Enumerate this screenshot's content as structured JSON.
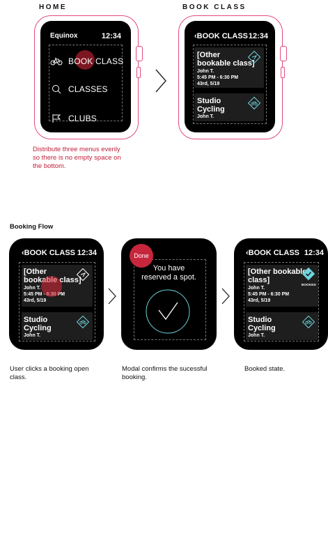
{
  "sections": {
    "home_label": "HOME",
    "book_class_label": "BOOK CLASS",
    "flow_label": "Booking Flow"
  },
  "home_screen": {
    "brand": "Equinox",
    "time": "12:34",
    "menu": [
      {
        "label": "BOOK CLASS",
        "icon": "bicycle-icon"
      },
      {
        "label": "CLASSES",
        "icon": "search-icon"
      },
      {
        "label": "CLUBS",
        "icon": "flag-icon"
      }
    ]
  },
  "book_class_screen": {
    "back": "‹",
    "title": "BOOK CLASS",
    "time": "12:34",
    "cards": [
      {
        "title_lines": [
          "[Other",
          "bookable class]"
        ],
        "instructor": "John T.",
        "time": "5:45 PM - 6:30 PM",
        "location": "43rd, 5/19",
        "icon": "booking-arrow-icon"
      },
      {
        "title_lines": [
          "Studio",
          "Cycling"
        ],
        "instructor": "John T.",
        "icon": "bicycle-diamond-icon"
      }
    ]
  },
  "flow_screen_1": {
    "back": "‹",
    "title": "BOOK CLASS",
    "time": "12:34",
    "cards": [
      {
        "title_lines": [
          "[Other",
          "bookable class]"
        ],
        "instructor": "John T.",
        "time": "5:45 PM - 6:30 PM",
        "location": "43rd, 5/19",
        "icon": "booking-arrow-icon"
      },
      {
        "title_lines": [
          "Studio",
          "Cycling"
        ],
        "instructor": "John T.",
        "icon": "bicycle-diamond-icon"
      }
    ]
  },
  "flow_screen_2": {
    "done": "Done",
    "message_lines": [
      "You have",
      "reserved a spot."
    ],
    "icon": "checkmark-circle-icon"
  },
  "flow_screen_3": {
    "back": "‹",
    "title": "BOOK CLASS",
    "time": "12:34",
    "cards": [
      {
        "title_lines": [
          "[Other bookable",
          "class]"
        ],
        "instructor": "John T.",
        "time": "5:45 PM - 6:30 PM",
        "location": "43rd, 5/19",
        "icon": "booked-check-icon",
        "badge": "BOOKED"
      },
      {
        "title_lines": [
          "Studio",
          "Cycling"
        ],
        "instructor": "John T.",
        "icon": "bicycle-diamond-icon"
      }
    ]
  },
  "notes": {
    "home_note_lines": [
      "Distribute three menus evenly",
      "so there is no empty space on",
      "the bottom."
    ],
    "flow1_lines": [
      "User clicks a booking open",
      "class."
    ],
    "flow2_lines": [
      "Modal confirms the sucessful",
      "booking."
    ],
    "flow3_lines": [
      "Booked state."
    ]
  },
  "colors": {
    "outline": "#e34a7a",
    "note_red": "#c0203a",
    "tap": "#c8263c",
    "accent_teal": "#6fd3dc"
  }
}
